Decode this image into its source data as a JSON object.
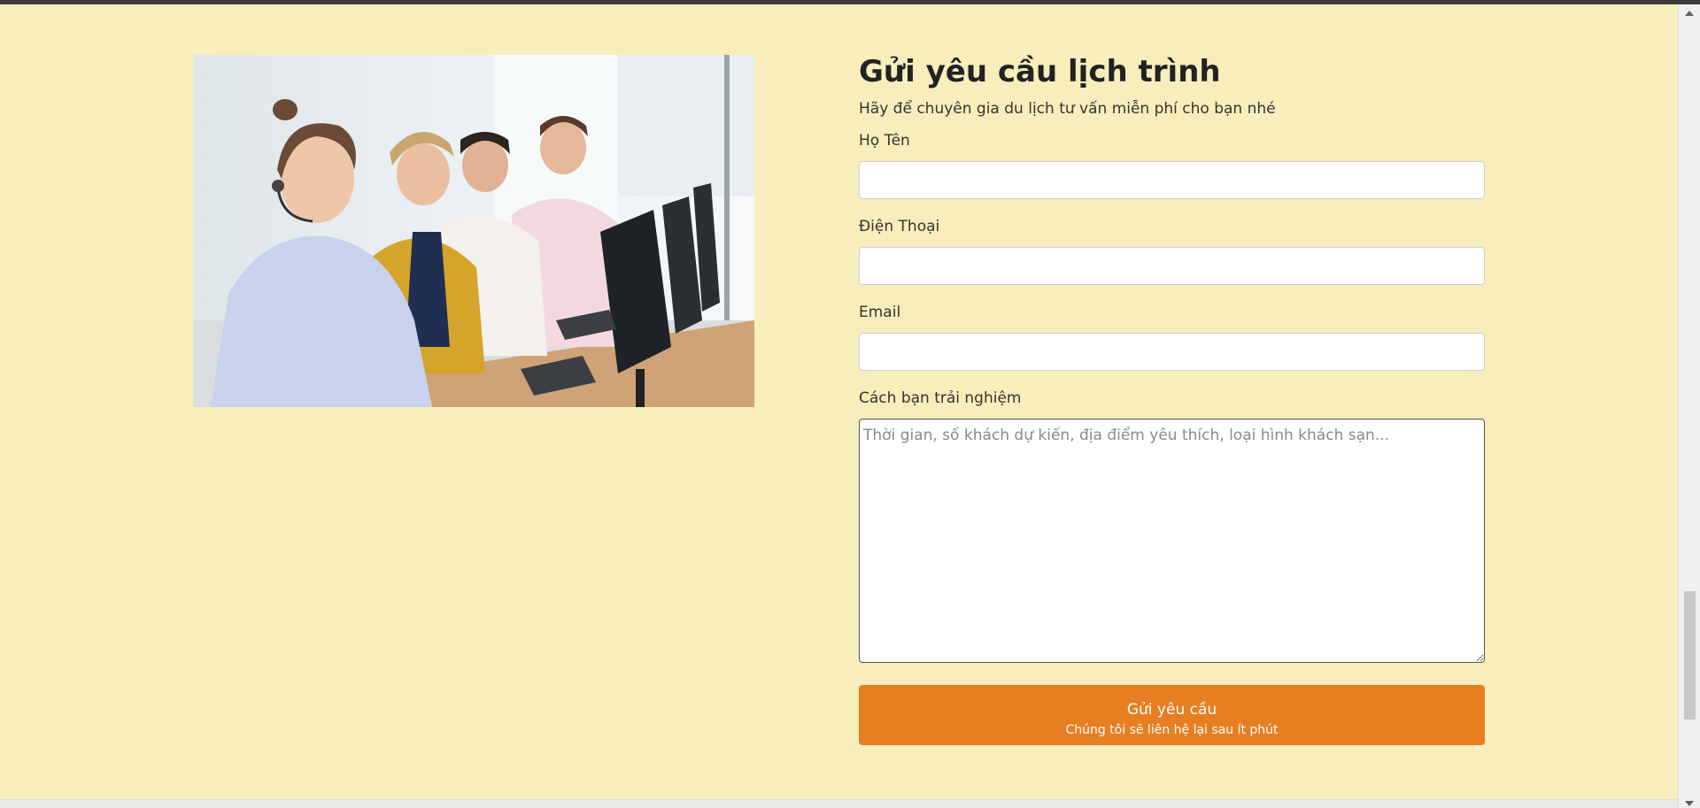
{
  "form": {
    "title": "Gửi yêu cầu lịch trình",
    "subtitle": "Hãy để chuyên gia du lịch tư vấn miễn phí cho bạn nhé",
    "fields": {
      "name_label": "Họ Tên",
      "phone_label": "Điện Thoại",
      "email_label": "Email",
      "experience_label": "Cách bạn trải nghiệm",
      "experience_placeholder": "Thời gian, số khách dự kiến, địa điểm yêu thích, loại hình khách sạn..."
    },
    "submit": {
      "label": "Gửi yêu cầu",
      "sublabel": "Chúng tôi sẽ liên hệ lại sau ít phút"
    }
  },
  "image": {
    "semantic": "call-center-agents-photo"
  },
  "colors": {
    "page_background": "#f8eebb",
    "button": "#e67e22",
    "button_text": "#ffffff"
  }
}
